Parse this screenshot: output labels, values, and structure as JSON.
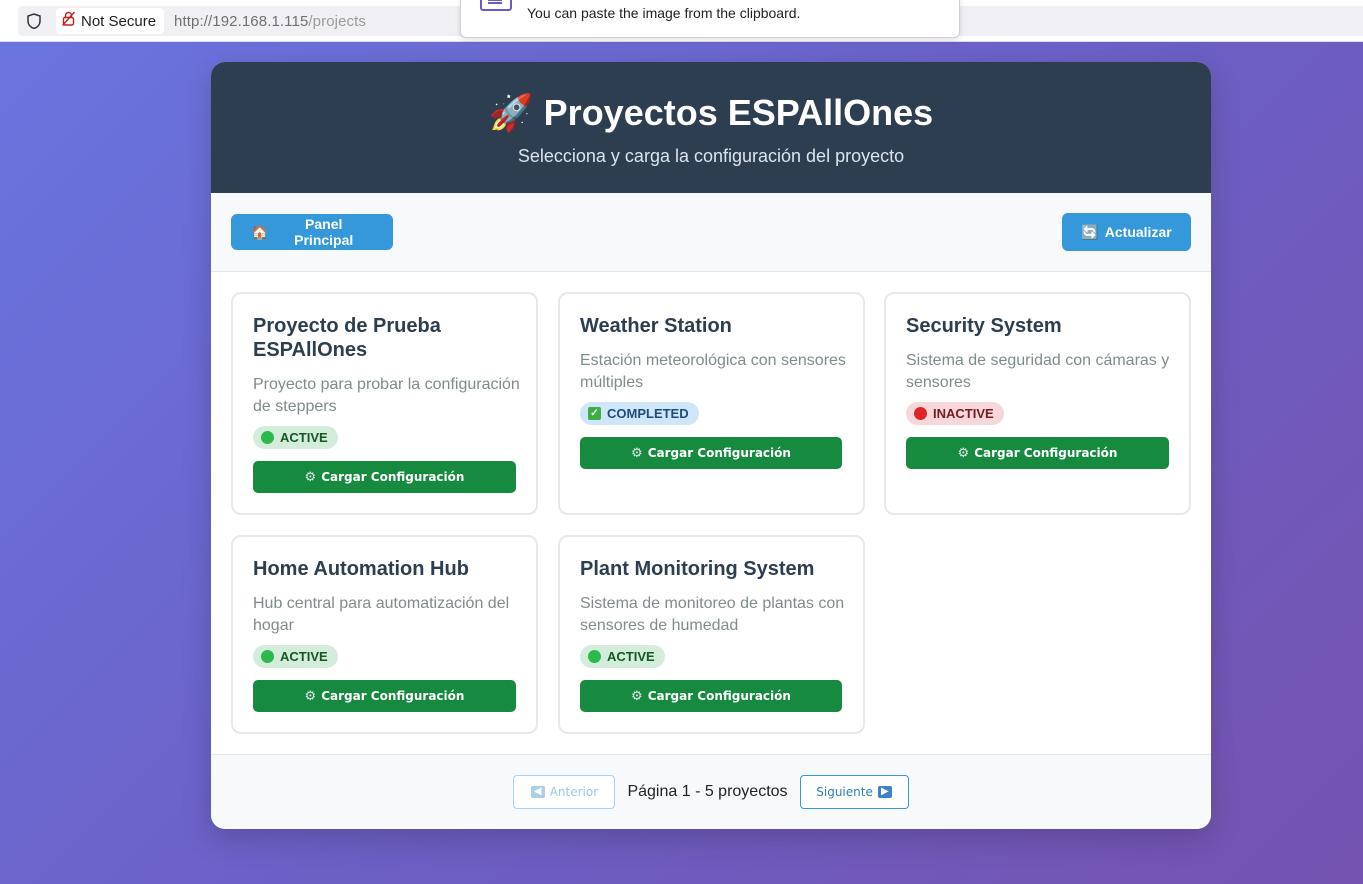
{
  "browser": {
    "security_label": "Not Secure",
    "url_host": "http://192.168.1.115",
    "url_path": "/projects"
  },
  "popup": {
    "message": "You can paste the image from the clipboard."
  },
  "header": {
    "title": "Proyectos ESPAllOnes",
    "subtitle": "Selecciona y carga la configuración del proyecto"
  },
  "toolbar": {
    "home_label": "Panel Principal",
    "refresh_label": "Actualizar"
  },
  "projects": [
    {
      "title": "Proyecto de Prueba ESPAllOnes",
      "description": "Proyecto para probar la configuración de steppers",
      "status": "ACTIVE",
      "button_label": "Cargar Configuración"
    },
    {
      "title": "Weather Station",
      "description": "Estación meteorológica con sensores múltiples",
      "status": "COMPLETED",
      "button_label": "Cargar Configuración"
    },
    {
      "title": "Security System",
      "description": "Sistema de seguridad con cámaras y sensores",
      "status": "INACTIVE",
      "button_label": "Cargar Configuración"
    },
    {
      "title": "Home Automation Hub",
      "description": "Hub central para automatización del hogar",
      "status": "ACTIVE",
      "button_label": "Cargar Configuración"
    },
    {
      "title": "Plant Monitoring System",
      "description": "Sistema de monitoreo de plantas con sensores de humedad",
      "status": "ACTIVE",
      "button_label": "Cargar Configuración"
    }
  ],
  "pagination": {
    "prev_label": "Anterior",
    "info": "Página 1 - 5 proyectos",
    "next_label": "Siguiente"
  },
  "colors": {
    "header_bg": "#2d3e50",
    "primary_blue": "#3498db",
    "action_green": "#168a3f"
  }
}
